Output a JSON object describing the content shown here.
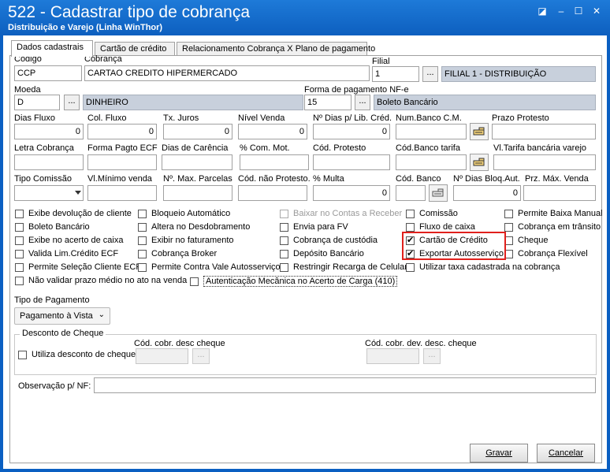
{
  "window": {
    "title": "522 - Cadastrar tipo de cobrança",
    "subtitle": "Distribuição e Varejo (Linha WinThor)",
    "controls": [
      "restore-icon",
      "minimize-icon",
      "maximize-icon",
      "close-icon"
    ]
  },
  "tabs": [
    {
      "label": "Dados cadastrais",
      "active": true
    },
    {
      "label": "Cartão de crédito",
      "active": false
    },
    {
      "label": "Relacionamento Cobrança X Plano de pagamento",
      "active": false
    }
  ],
  "fields": {
    "codigo": {
      "label": "Código",
      "value": "CCP"
    },
    "cobranca": {
      "label": "Cobrança",
      "value": "CARTAO CREDITO HIPERMERCADO"
    },
    "filial": {
      "label": "Filial",
      "value": "1",
      "desc": "FILIAL 1 - DISTRIBUIÇÃO"
    },
    "moeda": {
      "label": "Moeda",
      "value": "D",
      "desc": "DINHEIRO"
    },
    "forma_nfe": {
      "label": "Forma de pagamento NF-e",
      "value": "15",
      "desc": "Boleto Bancário"
    },
    "row3": [
      {
        "label": "Dias Fluxo",
        "value": "0"
      },
      {
        "label": "Col. Fluxo",
        "value": "0"
      },
      {
        "label": "Tx. Juros",
        "value": "0"
      },
      {
        "label": "Nível Venda",
        "value": "0"
      },
      {
        "label": "Nº Dias p/ Lib. Créd.",
        "value": "0"
      },
      {
        "label": "Num.Banco C.M.",
        "value": ""
      },
      {
        "label": "Prazo Protesto",
        "value": ""
      }
    ],
    "row4": [
      {
        "label": "Letra Cobrança",
        "value": ""
      },
      {
        "label": "Forma Pagto ECF",
        "value": ""
      },
      {
        "label": "Dias de Carência",
        "value": ""
      },
      {
        "label": "% Com. Mot.",
        "value": ""
      },
      {
        "label": "Cód. Protesto",
        "value": ""
      },
      {
        "label": "Cód.Banco tarifa",
        "value": ""
      },
      {
        "label": "Vl.Tarifa bancária varejo",
        "value": ""
      }
    ],
    "row5": [
      {
        "label": "Tipo Comissão",
        "value": ""
      },
      {
        "label": "Vl.Mínimo venda",
        "value": ""
      },
      {
        "label": "Nº. Max. Parcelas",
        "value": ""
      },
      {
        "label": "Cód. não Protesto.",
        "value": ""
      },
      {
        "label": "% Multa",
        "value": "0"
      },
      {
        "label": "Cód. Banco",
        "value": ""
      },
      {
        "label": "Nº Dias Bloq.Aut.",
        "value": "0"
      },
      {
        "label": "Prz. Máx. Venda",
        "value": ""
      }
    ]
  },
  "checkboxes": {
    "col1": [
      {
        "label": "Exibe devolução de cliente",
        "checked": false
      },
      {
        "label": "Boleto Bancário",
        "checked": false
      },
      {
        "label": "Exibe no acerto de caixa",
        "checked": false
      },
      {
        "label": "Valida Lim.Crédito ECF",
        "checked": false
      },
      {
        "label": "Permite Seleção Cliente ECF",
        "checked": false
      },
      {
        "label": "Não validar prazo médio no ato na venda",
        "checked": false
      }
    ],
    "col2": [
      {
        "label": "Bloqueio Automático",
        "checked": false
      },
      {
        "label": "Altera no Desdobramento",
        "checked": false
      },
      {
        "label": "Exibir no faturamento",
        "checked": false
      },
      {
        "label": "Cobrança Broker",
        "checked": false
      },
      {
        "label": "Permite Contra Vale Autosserviço",
        "checked": false
      },
      {
        "label": "Autenticação Mecânica no Acerto de Carga (410)",
        "checked": false
      }
    ],
    "col3": [
      {
        "label": "Baixar no Contas a Receber",
        "checked": false,
        "disabled": true
      },
      {
        "label": "Envia para FV",
        "checked": false
      },
      {
        "label": "Cobrança de custódia",
        "checked": false
      },
      {
        "label": "Depósito Bancário",
        "checked": false
      },
      {
        "label": "Restringir Recarga de Celular",
        "checked": false
      }
    ],
    "col4": [
      {
        "label": "Comissão",
        "checked": false
      },
      {
        "label": "Fluxo de caixa",
        "checked": false
      },
      {
        "label": "Cartão de Crédito",
        "checked": true
      },
      {
        "label": "Exportar Autosserviço",
        "checked": true
      },
      {
        "label": "Utilizar taxa cadastrada na cobrança",
        "checked": false
      }
    ],
    "col5": [
      {
        "label": "Permite Baixa Manual",
        "checked": false
      },
      {
        "label": "Cobrança em trânsito",
        "checked": false
      },
      {
        "label": "Cheque",
        "checked": false
      },
      {
        "label": "Cobrança Flexível",
        "checked": false
      }
    ]
  },
  "tipo_pagamento": {
    "label": "Tipo de Pagamento",
    "value": "Pagamento à Vista"
  },
  "desconto_cheque": {
    "title": "Desconto de Cheque",
    "checkbox": "Utiliza desconto de cheque",
    "desc_label": "Cód. cobr. desc cheque",
    "dev_label": "Cód. cobr. dev. desc. cheque"
  },
  "observacao": {
    "label": "Observação p/ NF:",
    "value": ""
  },
  "buttons": {
    "gravar": "Gravar",
    "cancelar": "Cancelar",
    "ellipsis": "..."
  },
  "colors": {
    "titlebar": "#0d5fbf",
    "highlight": "#e0201c",
    "readonly": "#c8d0dc"
  }
}
